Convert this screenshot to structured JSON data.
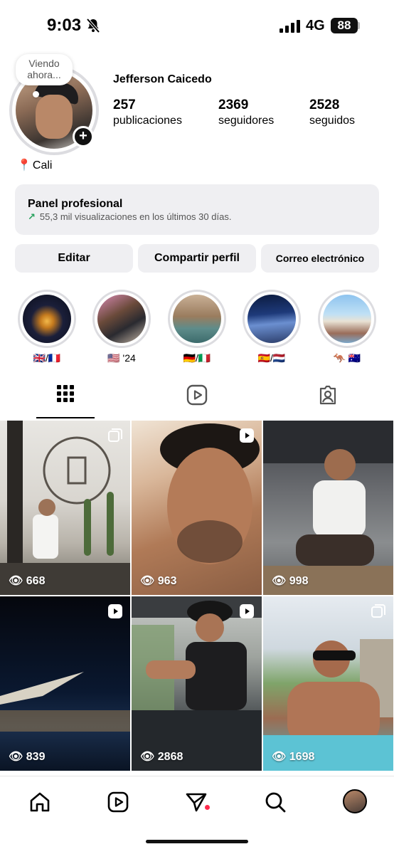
{
  "status_bar": {
    "time": "9:03",
    "network": "4G",
    "battery": "88"
  },
  "profile": {
    "note": "Viendo ahora...",
    "name": "Jefferson Caicedo",
    "stats": [
      {
        "value": "257",
        "label": "publicaciones"
      },
      {
        "value": "2369",
        "label": "seguidores"
      },
      {
        "value": "2528",
        "label": "seguidos"
      }
    ],
    "location": "Cali"
  },
  "panel": {
    "title": "Panel profesional",
    "subtitle": "55,3 mil visualizaciones en los últimos 30 días."
  },
  "buttons": {
    "edit": "Editar",
    "share": "Compartir perfil",
    "email": "Correo electrónico"
  },
  "highlights": [
    {
      "label": "🇬🇧/🇫🇷"
    },
    {
      "label": "🇺🇸 '24"
    },
    {
      "label": "🇩🇪/🇮🇹"
    },
    {
      "label": "🇪🇸/🇳🇱"
    },
    {
      "label": "🦘 🇦🇺"
    }
  ],
  "posts": [
    {
      "views": "668",
      "type": "carousel"
    },
    {
      "views": "963",
      "type": "reel"
    },
    {
      "views": "998",
      "type": "none"
    },
    {
      "views": "839",
      "type": "reel"
    },
    {
      "views": "2868",
      "type": "reel"
    },
    {
      "views": "1698",
      "type": "carousel"
    }
  ],
  "colors": {
    "accent_green": "#23a05a",
    "notification_dot": "#ff2b4d",
    "button_bg": "#efeff2"
  }
}
